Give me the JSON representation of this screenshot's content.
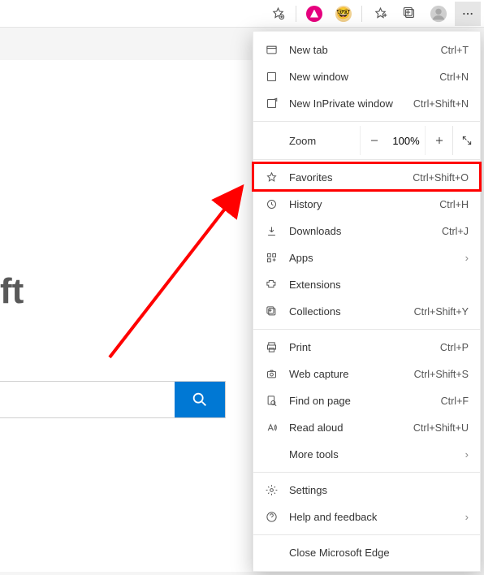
{
  "toolbar": {
    "star_add": "☆",
    "favorites": "☆",
    "collections": "⊞",
    "profile": "👤",
    "more": "⋯"
  },
  "page": {
    "partial_text": "ft",
    "search_placeholder": ""
  },
  "menu": {
    "new_tab": {
      "label": "New tab",
      "shortcut": "Ctrl+T"
    },
    "new_window": {
      "label": "New window",
      "shortcut": "Ctrl+N"
    },
    "new_inprivate": {
      "label": "New InPrivate window",
      "shortcut": "Ctrl+Shift+N"
    },
    "zoom": {
      "label": "Zoom",
      "value": "100%"
    },
    "favorites": {
      "label": "Favorites",
      "shortcut": "Ctrl+Shift+O"
    },
    "history": {
      "label": "History",
      "shortcut": "Ctrl+H"
    },
    "downloads": {
      "label": "Downloads",
      "shortcut": "Ctrl+J"
    },
    "apps": {
      "label": "Apps"
    },
    "extensions": {
      "label": "Extensions"
    },
    "collections": {
      "label": "Collections",
      "shortcut": "Ctrl+Shift+Y"
    },
    "print": {
      "label": "Print",
      "shortcut": "Ctrl+P"
    },
    "web_capture": {
      "label": "Web capture",
      "shortcut": "Ctrl+Shift+S"
    },
    "find": {
      "label": "Find on page",
      "shortcut": "Ctrl+F"
    },
    "read_aloud": {
      "label": "Read aloud",
      "shortcut": "Ctrl+Shift+U"
    },
    "more_tools": {
      "label": "More tools"
    },
    "settings": {
      "label": "Settings"
    },
    "help": {
      "label": "Help and feedback"
    },
    "close": {
      "label": "Close Microsoft Edge"
    }
  }
}
